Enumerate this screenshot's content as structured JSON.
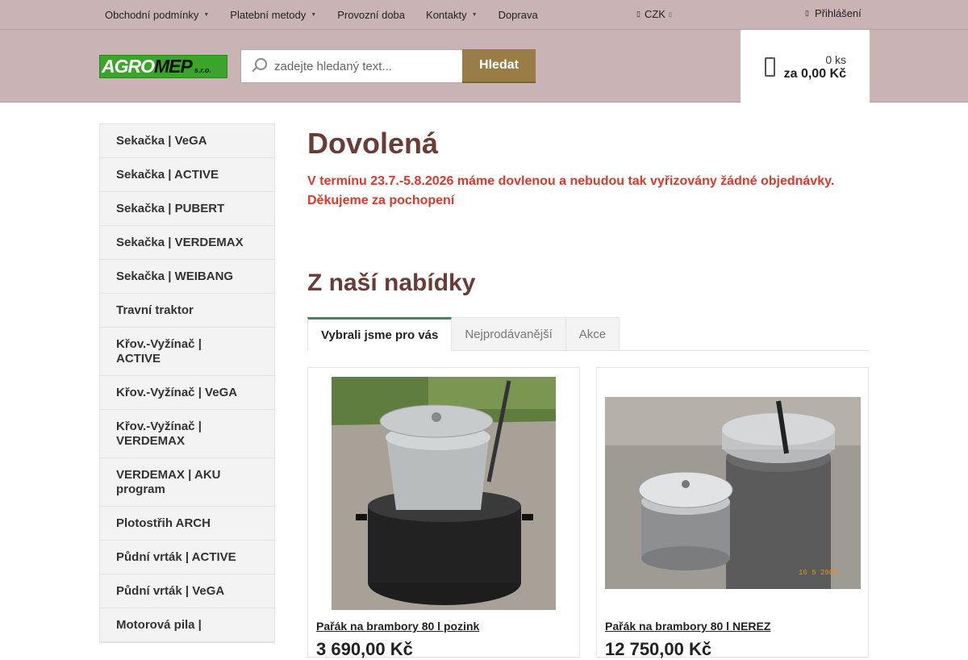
{
  "topnav": {
    "items": [
      {
        "label": "Obchodní podmínky",
        "dropdown": true
      },
      {
        "label": "Platební metody",
        "dropdown": true
      },
      {
        "label": "Provozní doba",
        "dropdown": false
      },
      {
        "label": "Kontakty",
        "dropdown": true
      },
      {
        "label": "Doprava",
        "dropdown": false
      }
    ],
    "currency": "CZK",
    "login": "Přihlášení"
  },
  "logo": {
    "part1": "AGRO",
    "part2": "MEP",
    "part3": "s.r.o."
  },
  "search": {
    "placeholder": "zadejte hledaný text...",
    "button": "Hledat"
  },
  "cart": {
    "quantity": "0 ks",
    "total": "za 0,00 Kč"
  },
  "sidebar": {
    "items": [
      "Sekačka | VeGA",
      "Sekačka | ACTIVE",
      "Sekačka | PUBERT",
      "Sekačka | VERDEMAX",
      "Sekačka | WEIBANG",
      "Travní traktor",
      "Křov.-Vyžínač | ACTIVE",
      "Křov.-Vyžínač | VeGA",
      "Křov.-Vyžínač | VERDEMAX",
      "VERDEMAX | AKU program",
      "Plotostřih ARCH",
      "Půdní vrták | ACTIVE",
      "Půdní vrták | VeGA",
      "Motorová pila |"
    ]
  },
  "main": {
    "vacation_title": "Dovolená",
    "vacation_line1": "V termínu 23.7.-5.8.2026 máme dovlenou a nebudou tak vyřizovány žádné objednávky.",
    "vacation_line2": "Děkujeme za pochopení",
    "offer_title": "Z naší nabídky",
    "tabs": [
      "Vybrali jsme pro vás",
      "Nejprodávanější",
      "Akce"
    ],
    "active_tab": "Vybrali jsme pro vás",
    "products": [
      {
        "name": "Pařák na brambory 80 l pozink",
        "price": "3 690,00 Kč"
      },
      {
        "name": "Pařák na brambory 80 l NEREZ",
        "price": "12 750,00 Kč"
      }
    ]
  },
  "colors": {
    "topbar": "#c9b3b4",
    "accent_button": "#9a7c46",
    "heading": "#6b3b36",
    "notice": "#e0372a",
    "logo_green": "#3aa52b",
    "tab_active_border": "#3d8a5d"
  },
  "icons": [
    "chevron-down-icon",
    "globe-icon",
    "user-icon",
    "search-icon",
    "cart-icon"
  ]
}
